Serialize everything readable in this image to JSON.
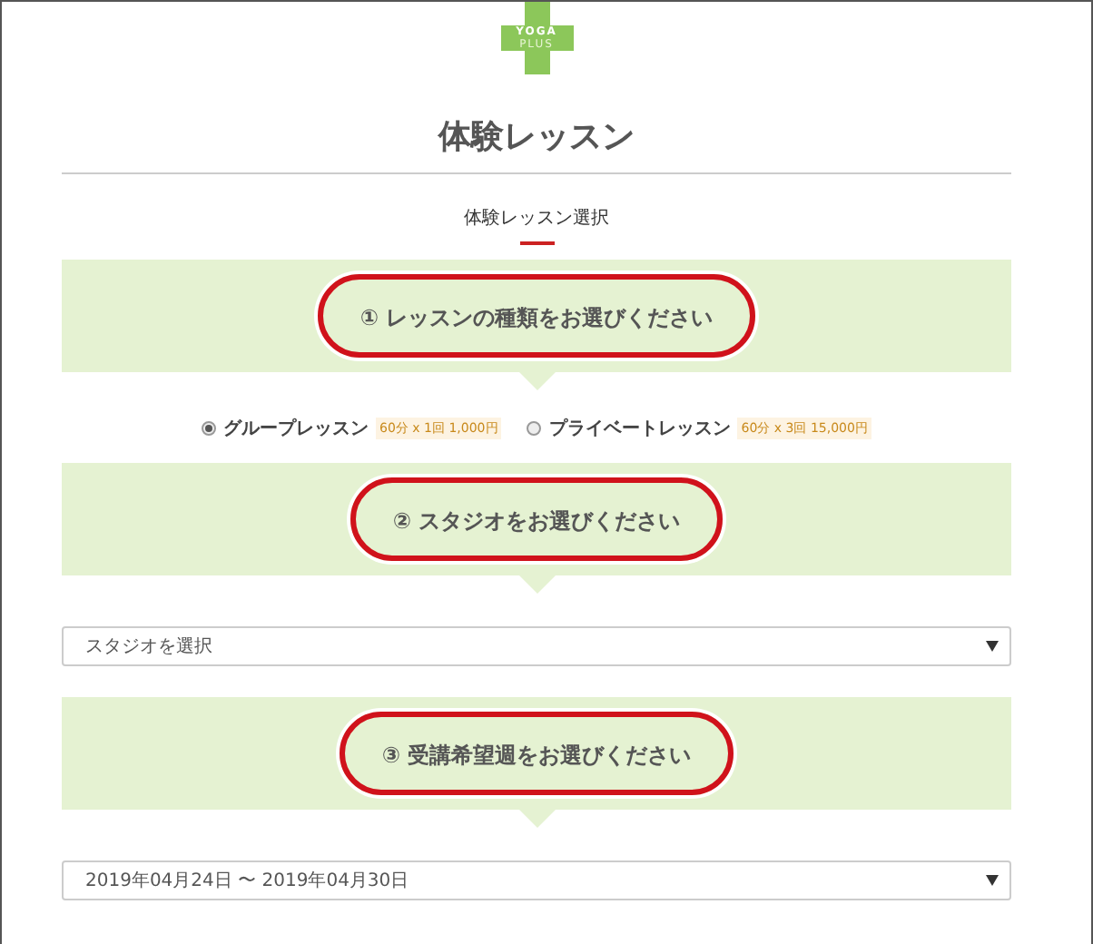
{
  "logo": {
    "line_1": "YOGA",
    "line_2": "PLUS"
  },
  "title": "体験レッスン",
  "step_tab": {
    "label": "体験レッスン選択",
    "selected": true
  },
  "sections": [
    {
      "heading": "① レッスンの種類をお選びください",
      "highlighted": true,
      "kind": "radios",
      "options": [
        {
          "label": "グループレッスン",
          "price": "60分 x 1回 1,000円",
          "selected": true
        },
        {
          "label": "プライベートレッスン",
          "price": "60分 x 3回 15,000円",
          "selected": false
        }
      ]
    },
    {
      "heading": "② スタジオをお選びください",
      "highlighted": true,
      "kind": "select",
      "value": "スタジオを選択"
    },
    {
      "heading": "③ 受講希望週をお選びください",
      "highlighted": true,
      "kind": "select",
      "value": "2019年04月24日 〜 2019年04月30日"
    }
  ]
}
